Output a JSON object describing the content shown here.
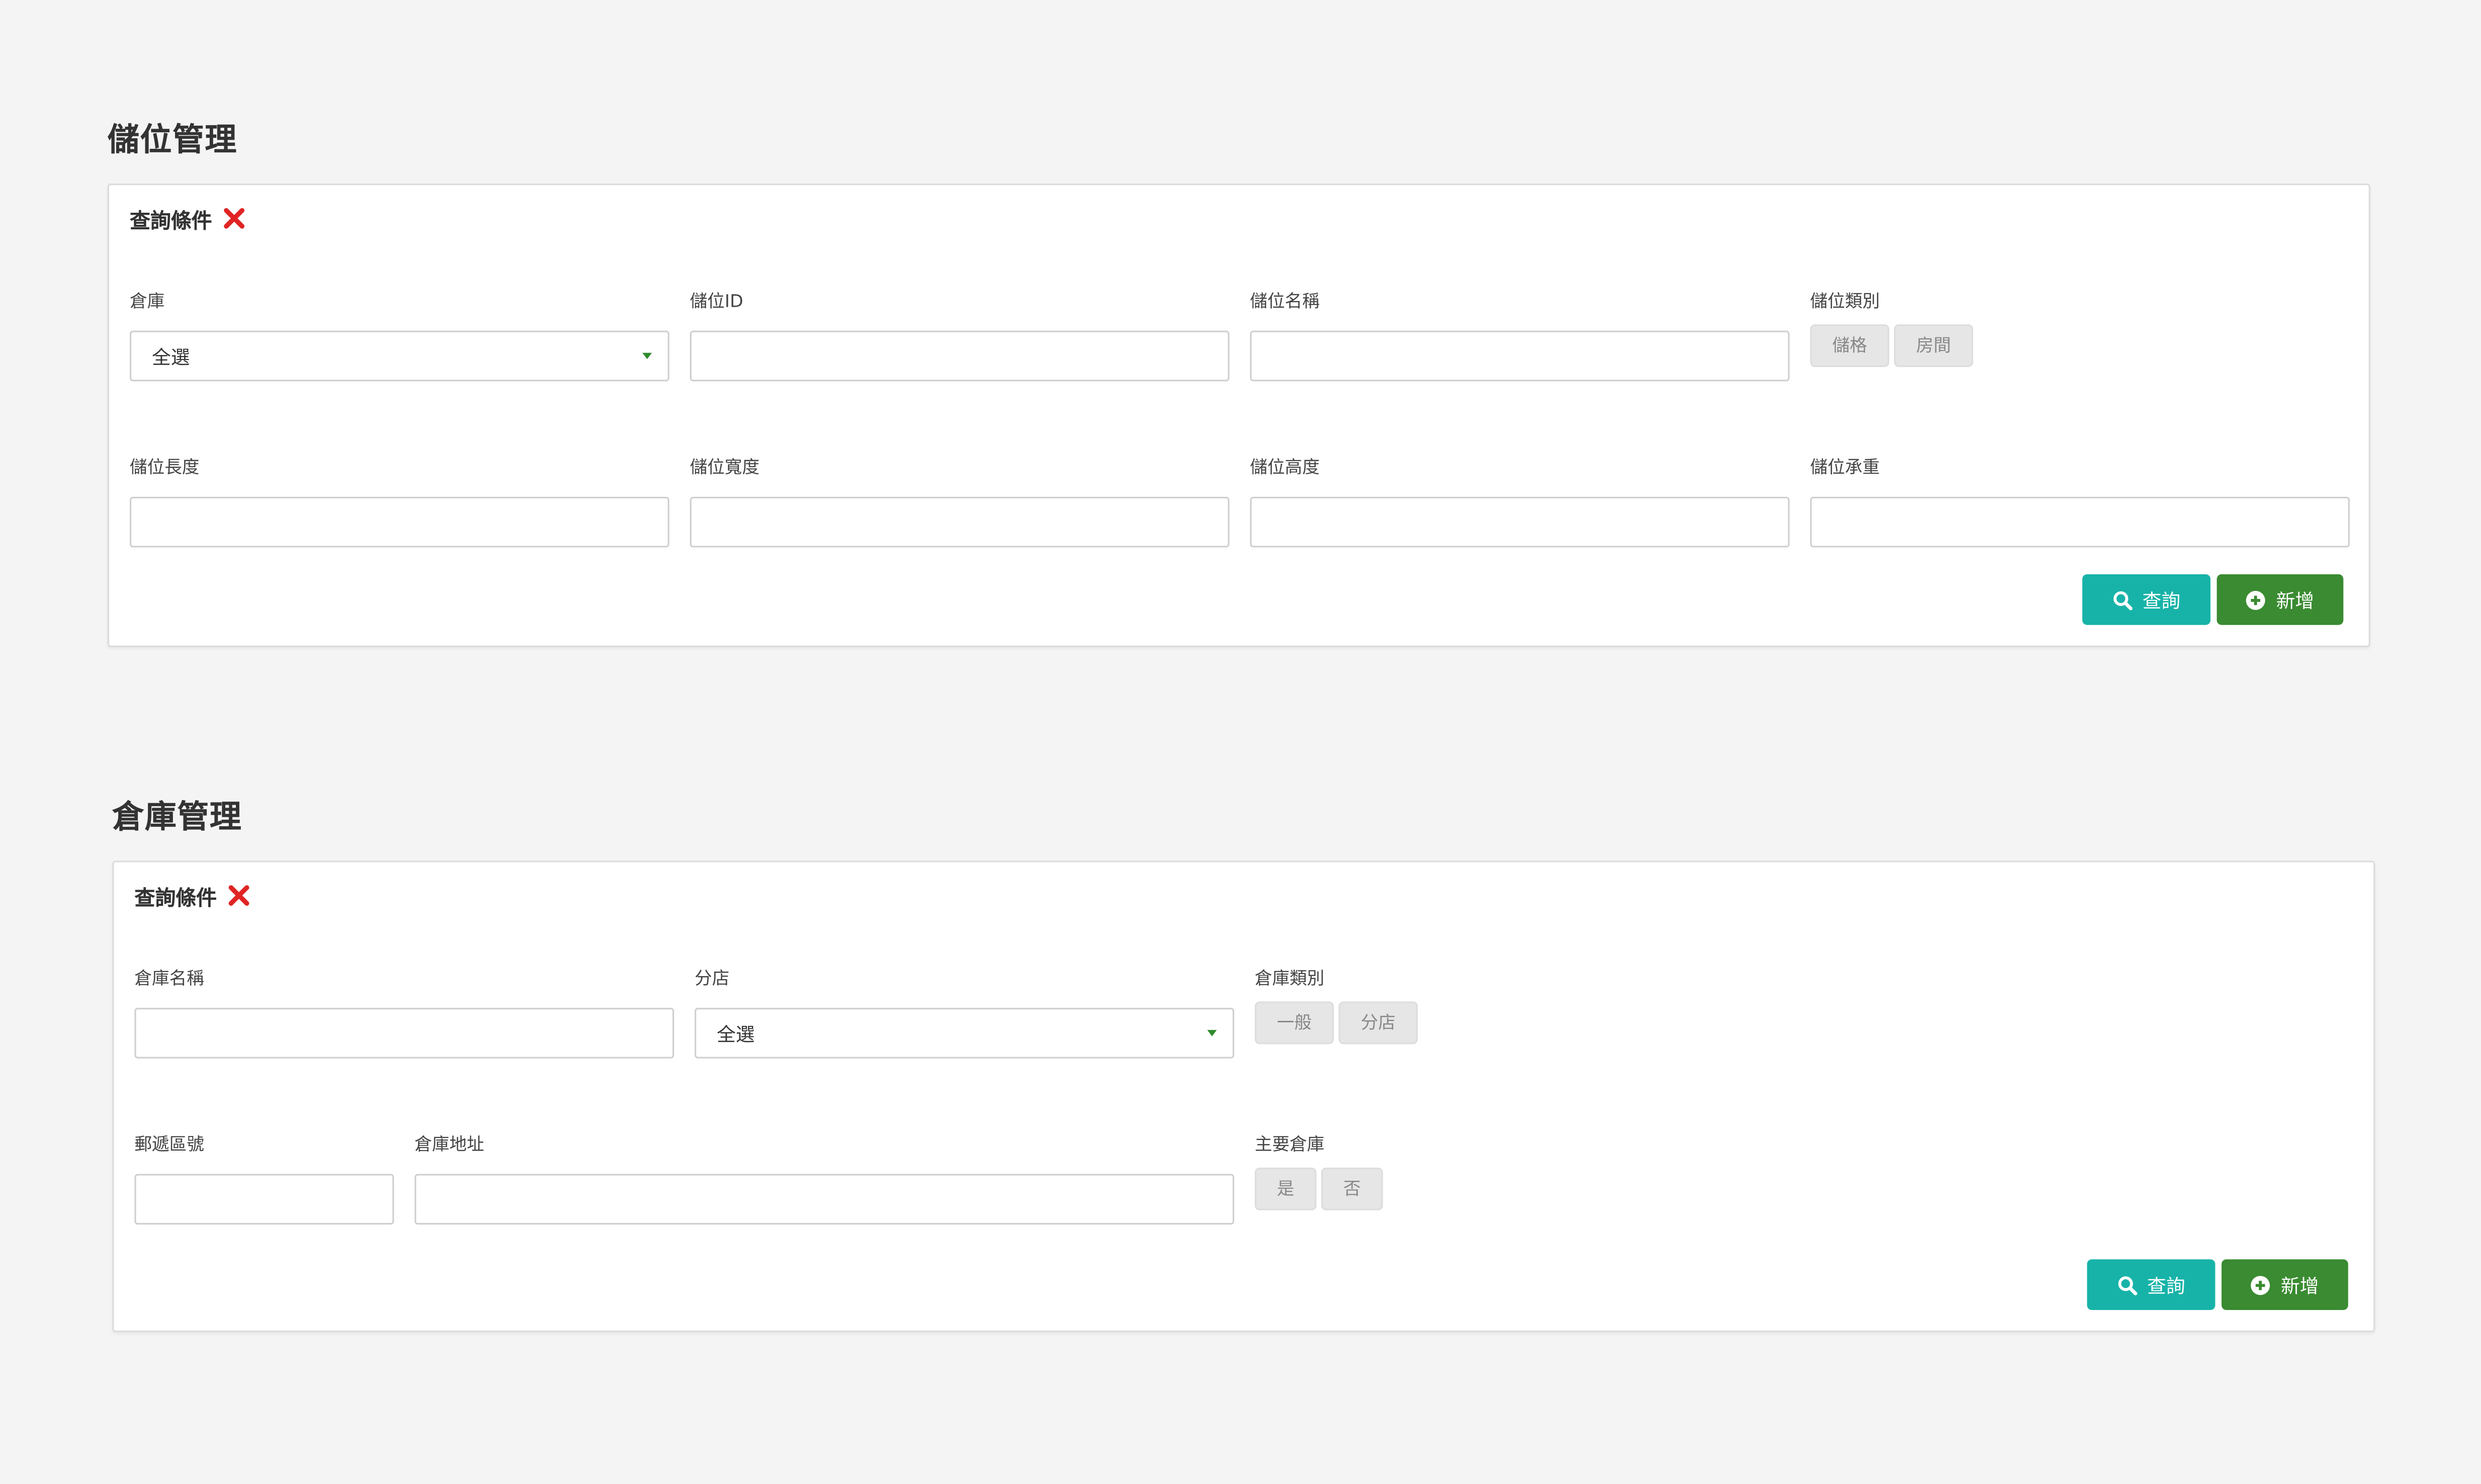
{
  "location_section": {
    "title": "儲位管理",
    "panel_title": "查詢條件",
    "fields": {
      "warehouse_label": "倉庫",
      "warehouse_value": "全選",
      "location_id_label": "儲位ID",
      "location_name_label": "儲位名稱",
      "location_type_label": "儲位類別",
      "location_type_options": [
        "儲格",
        "房間"
      ],
      "length_label": "儲位長度",
      "width_label": "儲位寬度",
      "height_label": "儲位高度",
      "load_label": "儲位承重"
    },
    "buttons": {
      "query": "查詢",
      "add": "新增"
    }
  },
  "warehouse_section": {
    "title": "倉庫管理",
    "panel_title": "查詢條件",
    "fields": {
      "warehouse_name_label": "倉庫名稱",
      "branch_label": "分店",
      "branch_value": "全選",
      "warehouse_type_label": "倉庫類別",
      "warehouse_type_options": [
        "一般",
        "分店"
      ],
      "postal_code_label": "郵遞區號",
      "address_label": "倉庫地址",
      "main_warehouse_label": "主要倉庫",
      "main_warehouse_options": [
        "是",
        "否"
      ]
    },
    "buttons": {
      "query": "查詢",
      "add": "新增"
    }
  },
  "colors": {
    "background": "#f4f4f4",
    "close_icon": "#e02424",
    "query_button": "#17b3a8",
    "add_button": "#3a8b31",
    "select_caret": "#2e8b2e"
  },
  "icons": {
    "close": "close-icon",
    "search": "search-icon",
    "add": "plus-circle-icon",
    "dropdown": "chevron-down-icon"
  }
}
